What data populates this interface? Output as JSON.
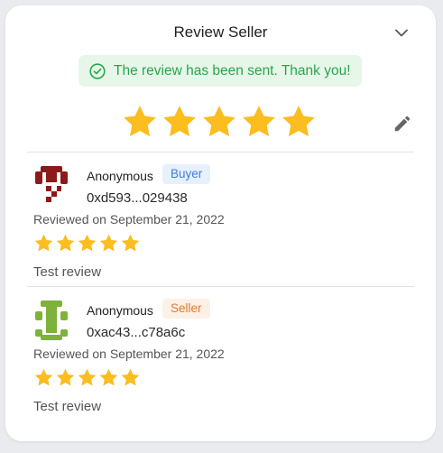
{
  "panel": {
    "title": "Review Seller",
    "collapse_icon": "chevron-down-icon",
    "edit_icon": "pencil-icon",
    "overall_rating": 5,
    "max_rating": 5
  },
  "toast": {
    "message": "The review has been sent. Thank you!",
    "icon": "check-circle-icon",
    "color": "#2aa54a",
    "background": "#e6f7ea"
  },
  "colors": {
    "star": "#fbbd1f",
    "buyer_badge_text": "#3d7fd6",
    "seller_badge_text": "#e27a2e"
  },
  "reviews": [
    {
      "name": "Anonymous",
      "role": "Buyer",
      "address": "0xd593...029438",
      "date": "Reviewed on September 21, 2022",
      "rating": 5,
      "comment": "Test review",
      "avatar_color": "#8b1a1a"
    },
    {
      "name": "Anonymous",
      "role": "Seller",
      "address": "0xac43...c78a6c",
      "date": "Reviewed on September 21, 2022",
      "rating": 5,
      "comment": "Test review",
      "avatar_color": "#7fb23a"
    }
  ]
}
